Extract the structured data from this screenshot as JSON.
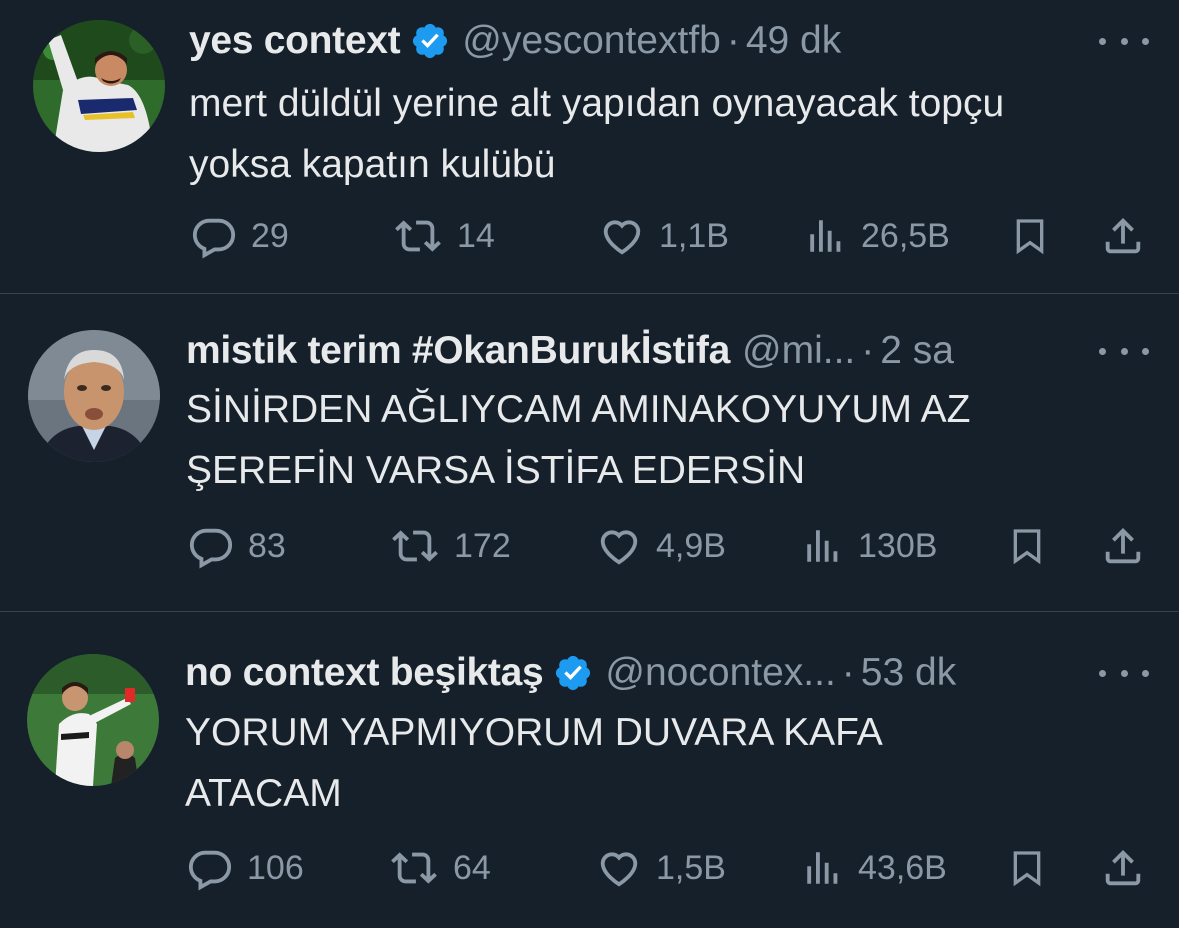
{
  "accent_color": "#1d9bf0",
  "tweets": [
    {
      "display_name": "yes context",
      "verified": true,
      "handle": "@yescontextfb",
      "separator": "·",
      "time": "49 dk",
      "text": "mert düldül yerine alt yapıdan oynayacak topçu\nyoksa kapatın kulübü",
      "replies": "29",
      "retweets": "14",
      "likes": "1,1B",
      "views": "26,5B",
      "avatar_icon": "footballer-avatar"
    },
    {
      "display_name": "mistik terim #OkanBurukİstifa",
      "verified": false,
      "handle": "@mi...",
      "separator": "·",
      "time": "2 sa",
      "text": "SİNİRDEN AĞLIYCAM AMINAKOYUYUM AZ\nŞEREFİN VARSA İSTİFA EDERSİN",
      "replies": "83",
      "retweets": "172",
      "likes": "4,9B",
      "views": "130B",
      "avatar_icon": "coach-avatar"
    },
    {
      "display_name": "no context beşiktaş",
      "verified": true,
      "handle": "@nocontex...",
      "separator": "·",
      "time": "53 dk",
      "text": "YORUM YAPMIYORUM DUVARA KAFA\nATACAM",
      "replies": "106",
      "retweets": "64",
      "likes": "1,5B",
      "views": "43,6B",
      "avatar_icon": "referee-avatar"
    }
  ]
}
